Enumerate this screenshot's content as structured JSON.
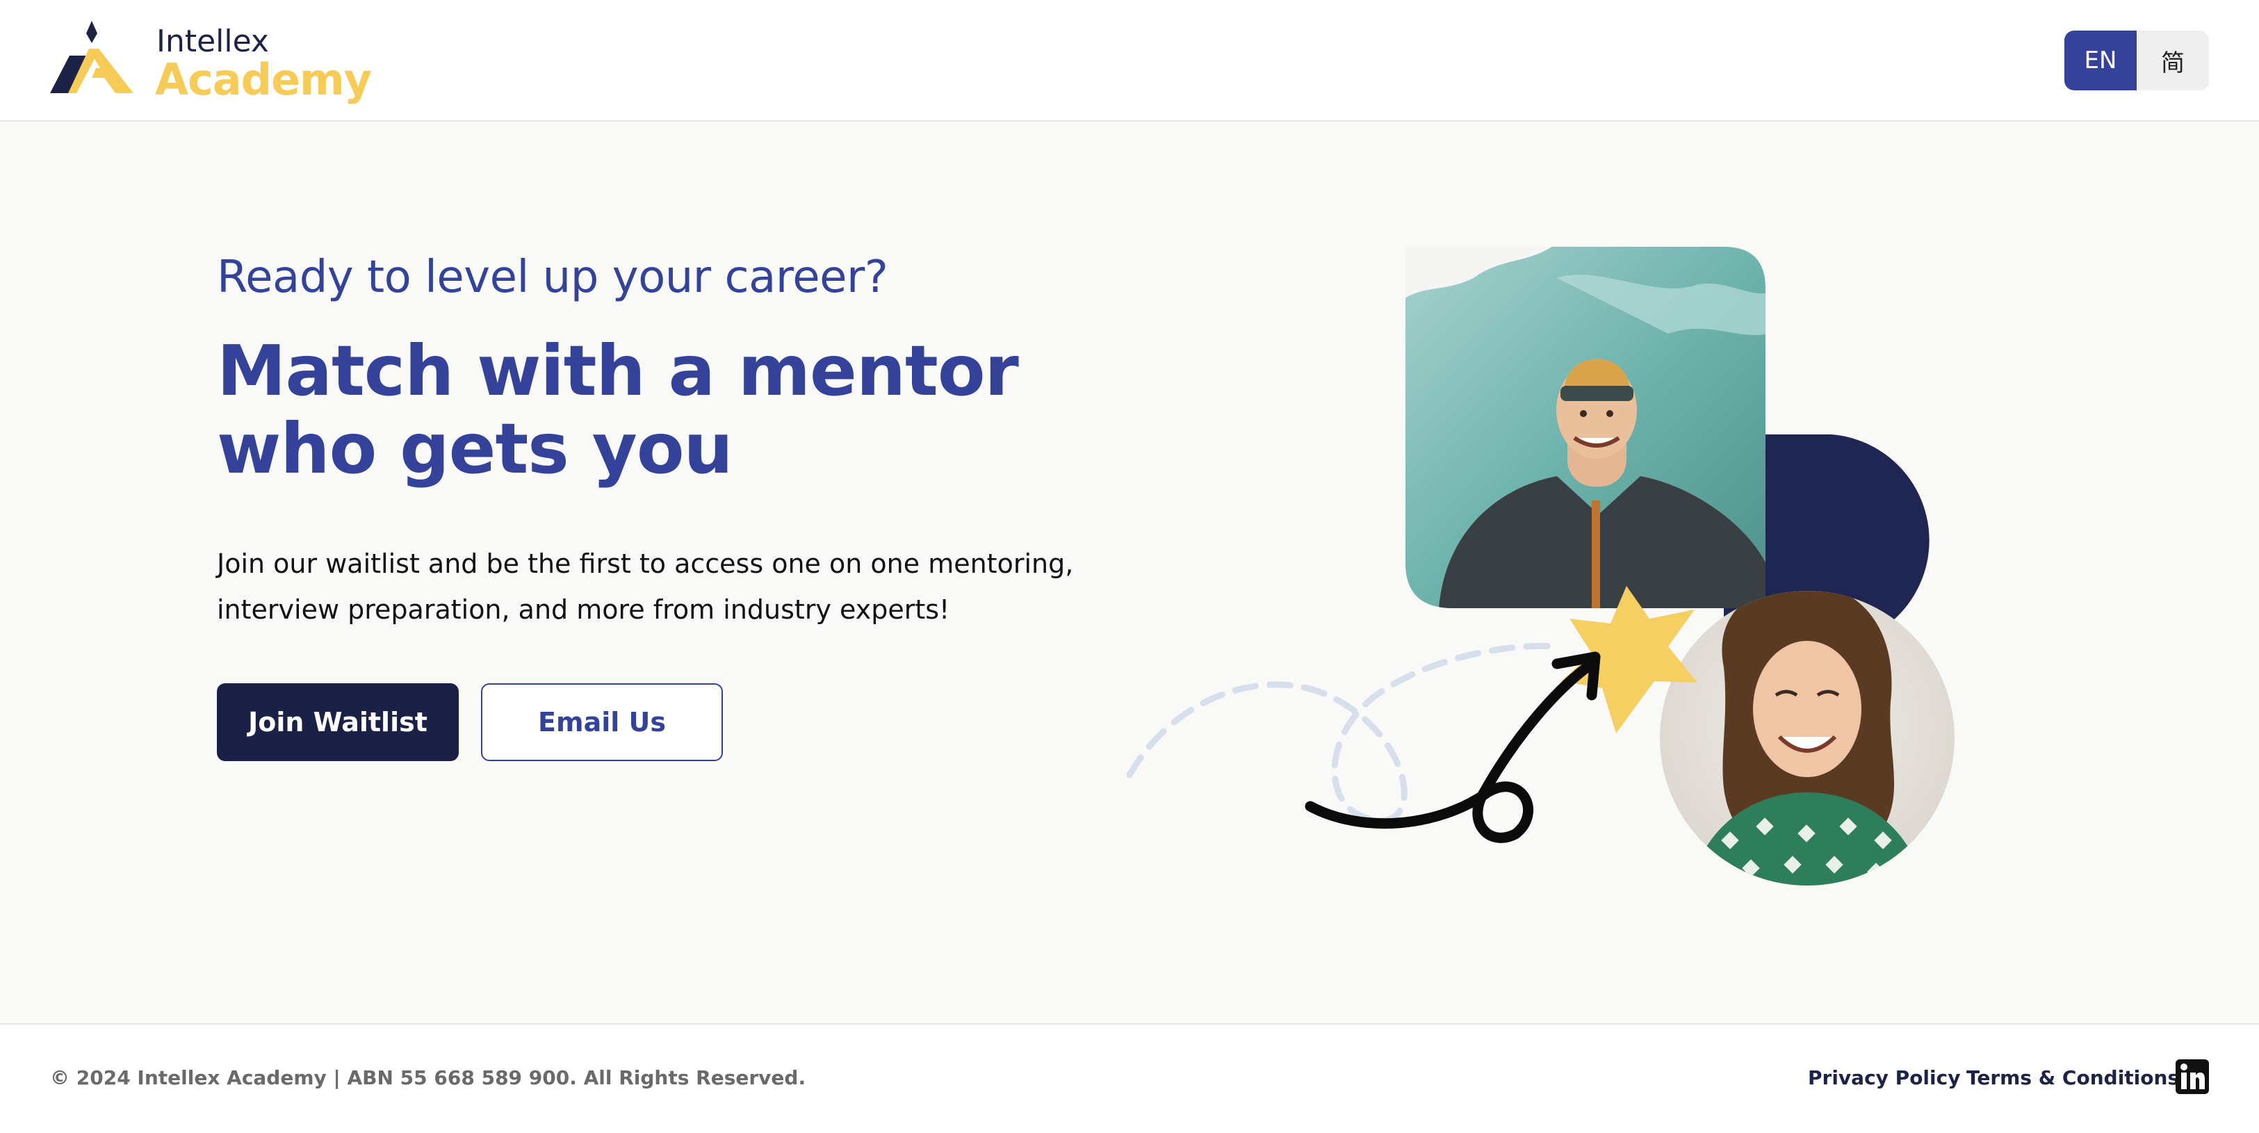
{
  "brand": {
    "line1": "Intellex",
    "line2": "Academy",
    "colors": {
      "navy": "#1c2347",
      "gold": "#f6cb57"
    }
  },
  "language_switcher": {
    "options": [
      {
        "label": "EN",
        "active": true
      },
      {
        "label": "简",
        "active": false
      }
    ]
  },
  "hero": {
    "kicker": "Ready to level up your career?",
    "headline": "Match with a mentor who gets you",
    "subtext": "Join our waitlist and be the first to access one on one mentoring, interview preparation, and more from industry experts!",
    "primary_button": "Join Waitlist",
    "secondary_button": "Email Us"
  },
  "illustration": {
    "images": [
      "mentor-photo-man",
      "mentor-photo-woman"
    ],
    "shapes": [
      "navy-pill",
      "yellow-starburst",
      "curly-arrow",
      "dashed-loop"
    ],
    "colors": {
      "navy": "#1f2652",
      "star": "#f6cf63",
      "dash": "#d6dfeb"
    }
  },
  "footer": {
    "copyright": "© 2024 Intellex Academy | ABN 55 668 589 900. All Rights Reserved.",
    "links": {
      "privacy": "Privacy Policy",
      "terms": "Terms & Conditions"
    },
    "social_icon": "linkedin-icon"
  },
  "theme": {
    "accent": "#34429a",
    "primary_button_bg": "#1b2046",
    "page_bg": "#f9f9f7"
  }
}
